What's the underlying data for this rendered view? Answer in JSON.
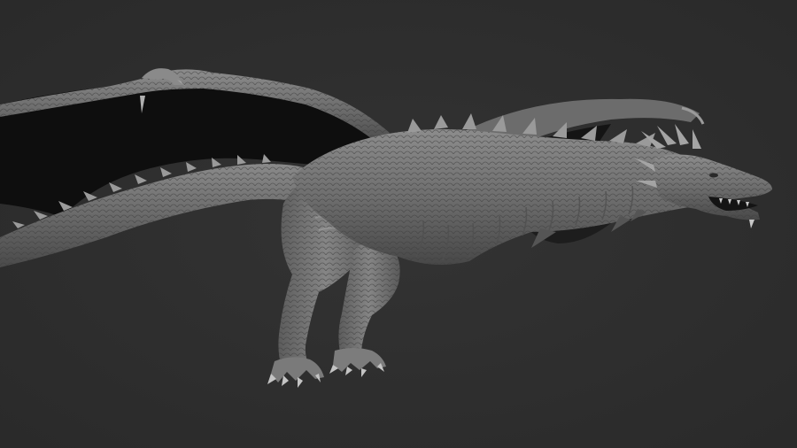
{
  "scene": {
    "subject": "dragon-sculpt",
    "colors": {
      "background": "#2f2f2f",
      "body_light": "#8a8a8a",
      "body_mid": "#6a6a6a",
      "body_dark": "#3f3f3f",
      "wing_membrane": "#0f0f0f",
      "spike": "#9a9a9a"
    }
  }
}
